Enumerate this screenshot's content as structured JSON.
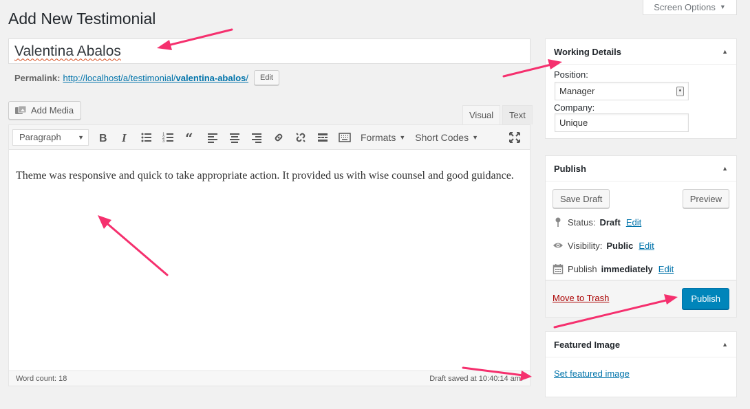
{
  "header": {
    "page_title": "Add New Testimonial",
    "screen_options": "Screen Options"
  },
  "post": {
    "title": "Valentina Abalos",
    "permalink_label": "Permalink:",
    "permalink_base": "http://localhost/a/testimonial/",
    "permalink_slug": "valentina-abalos",
    "permalink_trail": "/",
    "permalink_edit": "Edit"
  },
  "editor": {
    "add_media": "Add Media",
    "tabs": [
      "Visual",
      "Text"
    ],
    "format_select": "Paragraph",
    "formats_label": "Formats",
    "shortcodes_label": "Short Codes",
    "content": "Theme was responsive and quick to take appropriate action. It provided us with wise counsel and good guidance.",
    "word_count": "Word count: 18",
    "draft_saved": "Draft saved at 10:40:14 am."
  },
  "working_details": {
    "title": "Working Details",
    "position_label": "Position:",
    "position_value": "Manager",
    "company_label": "Company:",
    "company_value": "Unique"
  },
  "publish": {
    "title": "Publish",
    "save_draft": "Save Draft",
    "preview": "Preview",
    "status_label": "Status:",
    "status_value": "Draft",
    "visibility_label": "Visibility:",
    "visibility_value": "Public",
    "publish_label": "Publish",
    "publish_value": "immediately",
    "edit": "Edit",
    "move_to_trash": "Move to Trash",
    "publish_button": "Publish"
  },
  "featured_image": {
    "title": "Featured Image",
    "set_link": "Set featured image"
  },
  "colors": {
    "accent": "#0085ba",
    "link": "#0073aa",
    "trash": "#aa0000",
    "annotation_arrow": "#f5306e"
  }
}
